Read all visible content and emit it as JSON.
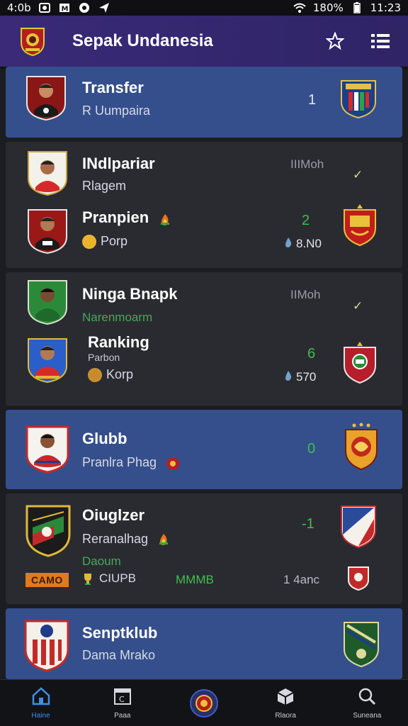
{
  "status_bar": {
    "time_left": "4:0b",
    "battery": "180%",
    "clock": "11:23"
  },
  "app_bar": {
    "title": "Sepak Undanesia",
    "icons": [
      "app-logo",
      "star-icon",
      "menu-list-icon"
    ]
  },
  "colors": {
    "app_bar": "#3a2a78",
    "card_blue": "#354f8c",
    "card_dark": "#2a2b31",
    "green": "#3fbf4f",
    "tag": "#e07a1f"
  },
  "cards": [
    {
      "title": "Transfer",
      "sub": "R Uumpaira",
      "value": "1"
    },
    {
      "row1": {
        "title": "INdlpariar",
        "sub": "Rlagem",
        "meta": "IIIMoh"
      },
      "row2": {
        "title": "Pranpien",
        "sub": "Porp",
        "value": "2",
        "score": "8.N0"
      }
    },
    {
      "row1": {
        "title": "Ninga Bnapk",
        "sub": "Narenmoarm",
        "meta": "IIMoh"
      },
      "row2": {
        "title": "Ranking",
        "sub_small": "Parbon",
        "sub": "Korp",
        "value": "6",
        "score": "570"
      }
    },
    {
      "title": "Glubb",
      "sub": "Pranlra Phag",
      "value": "0"
    },
    {
      "title": "Oiuglzer",
      "sub": "Reranalhag",
      "sub_green": "Daoum",
      "value": "-1",
      "tag": "CAMO",
      "club": "CIUPB",
      "mid": "MMMB",
      "right": "1  4anc"
    },
    {
      "title": "Senptklub",
      "sub": "Dama Mrako"
    }
  ],
  "bottom_nav": [
    {
      "label": "Haine",
      "icon": "home-icon"
    },
    {
      "label": "Paaa",
      "icon": "calendar-icon"
    },
    {
      "label": "",
      "icon": "center-badge-icon"
    },
    {
      "label": "Rlaora",
      "icon": "box-icon"
    },
    {
      "label": "Suneana",
      "icon": "search-icon"
    }
  ]
}
